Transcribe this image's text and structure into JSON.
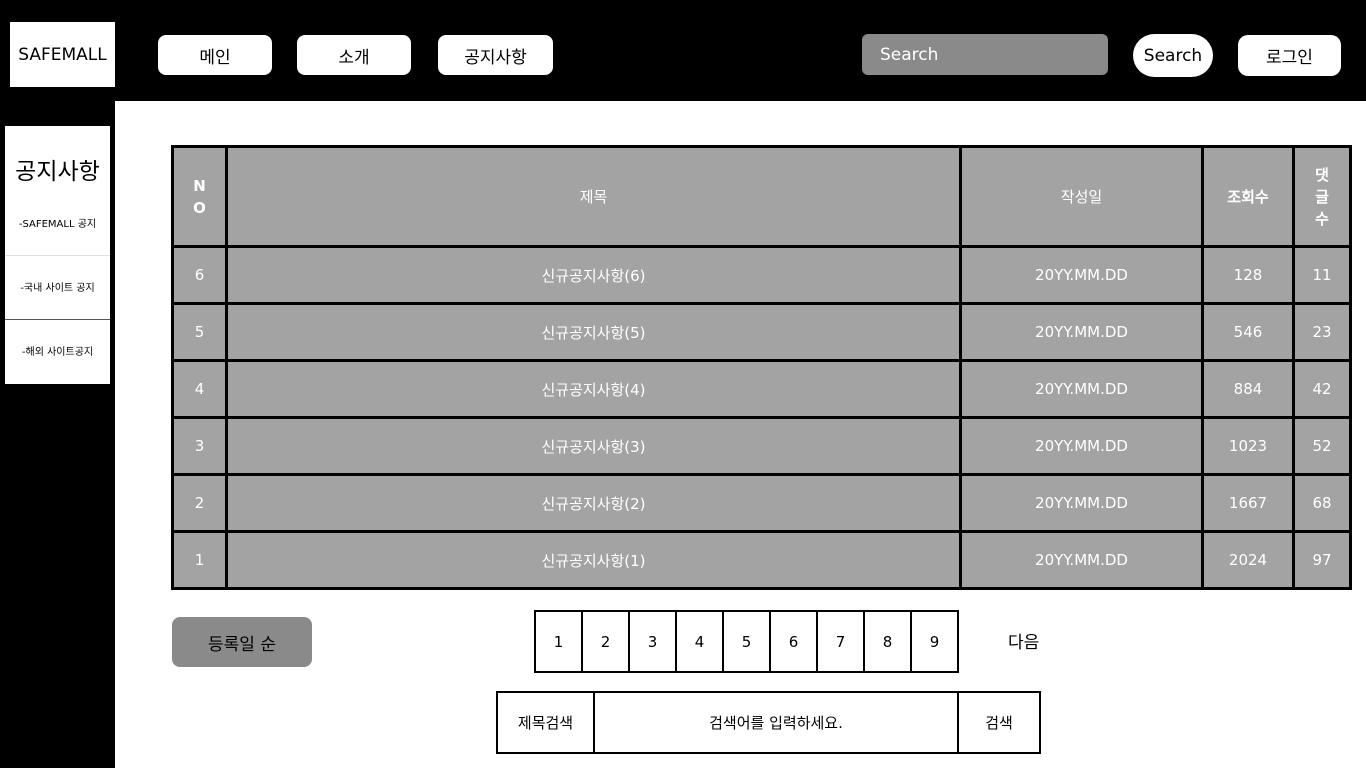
{
  "header": {
    "logo": "SAFEMALL",
    "nav": [
      {
        "label": "메인"
      },
      {
        "label": "소개"
      },
      {
        "label": "공지사항"
      }
    ],
    "search_placeholder": "Search",
    "search_button": "Search",
    "login_button": "로그인"
  },
  "sidebar": {
    "title": "공지사항",
    "items": [
      {
        "label": "-SAFEMALL 공지"
      },
      {
        "label": "-국내 사이트 공지"
      },
      {
        "label": "-해외 사이트공지"
      }
    ]
  },
  "table": {
    "headers": {
      "no": "NO",
      "title": "제목",
      "date": "작성일",
      "views": "조회수",
      "comments": "댓글수"
    },
    "rows": [
      {
        "no": "6",
        "title": "신규공지사항(6)",
        "date": "20YY.MM.DD",
        "views": "128",
        "comments": "11"
      },
      {
        "no": "5",
        "title": "신규공지사항(5)",
        "date": "20YY.MM.DD",
        "views": "546",
        "comments": "23"
      },
      {
        "no": "4",
        "title": "신규공지사항(4)",
        "date": "20YY.MM.DD",
        "views": "884",
        "comments": "42"
      },
      {
        "no": "3",
        "title": "신규공지사항(3)",
        "date": "20YY.MM.DD",
        "views": "1023",
        "comments": "52"
      },
      {
        "no": "2",
        "title": "신규공지사항(2)",
        "date": "20YY.MM.DD",
        "views": "1667",
        "comments": "68"
      },
      {
        "no": "1",
        "title": "신규공지사항(1)",
        "date": "20YY.MM.DD",
        "views": "2024",
        "comments": "97"
      }
    ]
  },
  "sort_button": "등록일 순",
  "pagination": {
    "pages": [
      "1",
      "2",
      "3",
      "4",
      "5",
      "6",
      "7",
      "8",
      "9"
    ],
    "next": "다음"
  },
  "bottom_search": {
    "type": "제목검색",
    "placeholder": "검색어를 입력하세요.",
    "button": "검색"
  },
  "colors": {
    "header_bg": "#000000",
    "table_bg": "#a3a3a3",
    "search_input_bg": "#8a8a8a",
    "sort_button_bg": "#8a8a8a"
  }
}
